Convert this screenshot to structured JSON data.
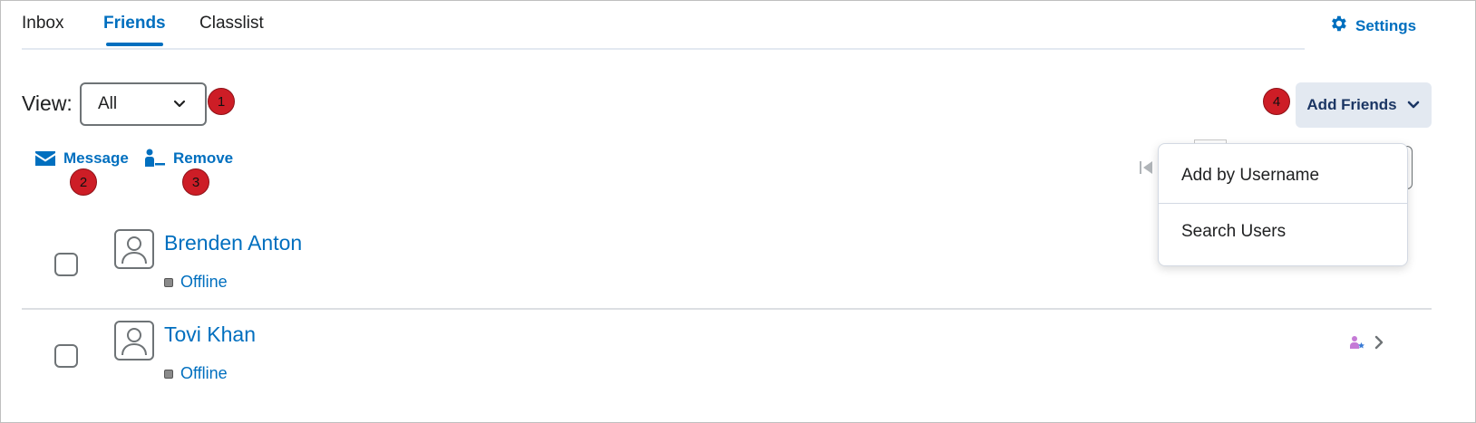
{
  "tabs": [
    {
      "label": "Inbox",
      "active": false
    },
    {
      "label": "Friends",
      "active": true
    },
    {
      "label": "Classlist",
      "active": false
    }
  ],
  "settings": {
    "label": "Settings",
    "icon": "gear-icon"
  },
  "view": {
    "label": "View:",
    "selected": "All"
  },
  "badges": {
    "one": "1",
    "two": "2",
    "three": "3",
    "four": "4"
  },
  "actions": {
    "message": {
      "label": "Message",
      "icon": "envelope-icon"
    },
    "remove": {
      "label": "Remove",
      "icon": "remove-user-icon"
    }
  },
  "add_friends": {
    "label": "Add Friends",
    "menu": [
      "Add by Username",
      "Search Users"
    ]
  },
  "friends": [
    {
      "name": "Brenden Anton",
      "status": "Offline"
    },
    {
      "name": "Tovi Khan",
      "status": "Offline"
    }
  ],
  "colors": {
    "accent": "#006fbf",
    "badge": "#cd1d26",
    "button_bg": "#e3e9f1"
  }
}
